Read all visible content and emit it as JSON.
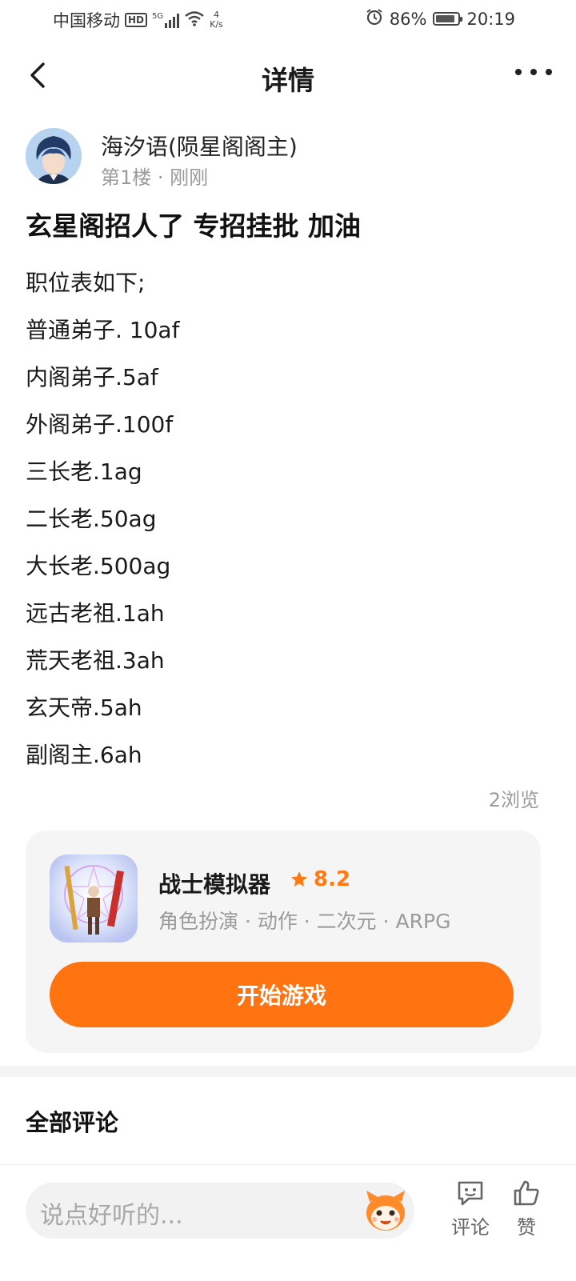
{
  "status_bar": {
    "carrier": "中国移动",
    "hd": "HD",
    "signal": "5G",
    "net_speed_value": "4",
    "net_speed_unit": "K/s",
    "battery": "86%",
    "battery_level": 0.86,
    "time": "20:19",
    "icons": [
      "alarm-icon",
      "wifi-icon",
      "signal-icon",
      "battery-icon"
    ]
  },
  "header": {
    "title": "详情",
    "back_icon": "chevron-left-icon",
    "more_icon": "more-horizontal-icon"
  },
  "post": {
    "author_name": "海汐语(陨星阁阁主)",
    "meta": "第1楼 · 刚刚",
    "title": "玄星阁招人了 专招挂批 加油",
    "lines": [
      "职位表如下;",
      "普通弟子. 10af",
      "内阁弟子.5af",
      "外阁弟子.100f",
      "三长老.1ag",
      "二长老.50ag",
      "大长老.500ag",
      "远古老祖.1ah",
      "荒天老祖.3ah",
      "玄天帝.5ah",
      "副阁主.6ah"
    ],
    "views": "2浏览"
  },
  "game_card": {
    "name": "战士模拟器",
    "rating": "8.2",
    "tags": "角色扮演 · 动作 · 二次元 · ARPG",
    "play_label": "开始游戏"
  },
  "comments": {
    "title": "全部评论"
  },
  "bottom_bar": {
    "placeholder": "说点好听的...",
    "comment_label": "评论",
    "like_label": "赞"
  },
  "colors": {
    "accent": "#ff7310",
    "rating": "#ff7a13",
    "muted_text": "#9a9a9a",
    "card_bg": "#f5f5f5"
  }
}
